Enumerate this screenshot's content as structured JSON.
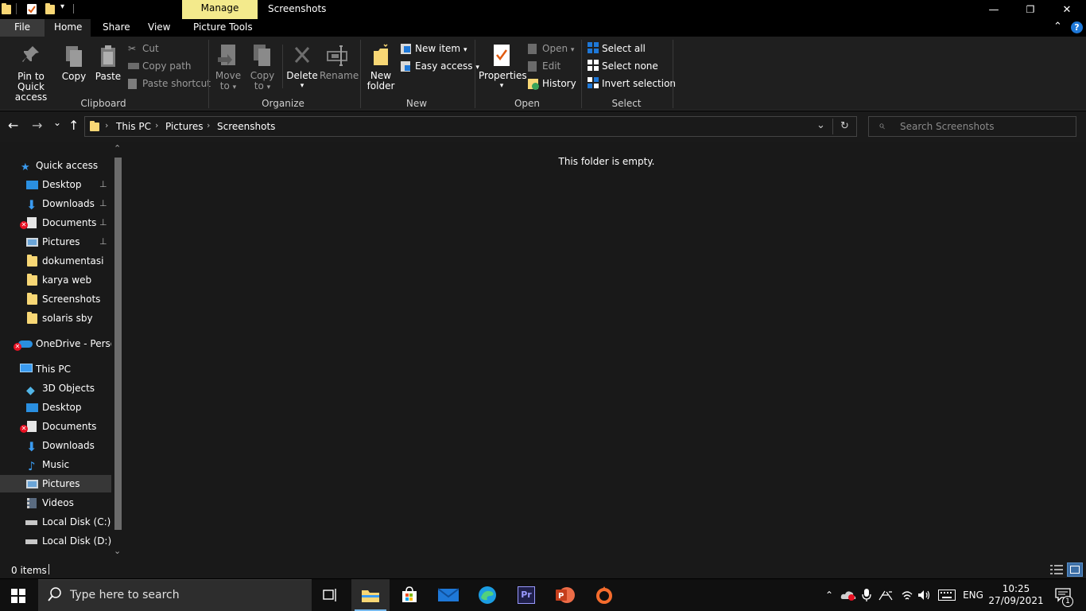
{
  "window": {
    "title": "Screenshots",
    "contextual_tab": "Manage",
    "minimize_glyph": "—",
    "maximize_glyph": "❐",
    "close_glyph": "✕"
  },
  "ribbon_tabs": {
    "file": "File",
    "home": "Home",
    "share": "Share",
    "view": "View",
    "picture_tools": "Picture Tools",
    "collapse_glyph": "⌃",
    "help_glyph": "?"
  },
  "ribbon": {
    "clipboard": {
      "pin_label_1": "Pin to Quick",
      "pin_label_2": "access",
      "copy": "Copy",
      "paste": "Paste",
      "cut": "Cut",
      "copy_path": "Copy path",
      "paste_shortcut": "Paste shortcut",
      "group": "Clipboard"
    },
    "organize": {
      "move_1": "Move",
      "move_2": "to",
      "copy_1": "Copy",
      "copy_2": "to",
      "delete": "Delete",
      "rename": "Rename",
      "group": "Organize"
    },
    "new": {
      "new_item": "New item",
      "easy_access": "Easy access",
      "new_folder_1": "New",
      "new_folder_2": "folder",
      "group": "New"
    },
    "open": {
      "properties": "Properties",
      "open": "Open",
      "edit": "Edit",
      "history": "History",
      "group": "Open"
    },
    "select": {
      "select_all": "Select all",
      "select_none": "Select none",
      "invert": "Invert selection",
      "group": "Select"
    }
  },
  "navbar": {
    "back_glyph": "←",
    "forward_glyph": "→",
    "recent_glyph": "⌄",
    "up_glyph": "↑",
    "breadcrumb": [
      "This PC",
      "Pictures",
      "Screenshots"
    ],
    "crumb_sep": "›",
    "dropdown_glyph": "⌄",
    "refresh_glyph": "↻",
    "search_placeholder": "Search Screenshots",
    "search_glyph": "⌕"
  },
  "navpane": {
    "quick_access": "Quick access",
    "qa_items": [
      "Desktop",
      "Downloads",
      "Documents",
      "Pictures",
      "dokumentasi",
      "karya web",
      "Screenshots",
      "solaris sby"
    ],
    "onedrive": "OneDrive - Personal",
    "this_pc": "This PC",
    "pc_items": [
      "3D Objects",
      "Desktop",
      "Documents",
      "Downloads",
      "Music",
      "Pictures",
      "Videos",
      "Local Disk (C:)",
      "Local Disk (D:)"
    ],
    "pin_glyph": "📌",
    "scroll_up": "⌃",
    "scroll_down": "⌄"
  },
  "main": {
    "empty_message": "This folder is empty."
  },
  "statusbar": {
    "item_count": "0 items"
  },
  "taskbar": {
    "search_placeholder": "Type here to search",
    "language": "ENG",
    "time": "10:25",
    "date": "27/09/2021",
    "notification_count": "1"
  },
  "colors": {
    "folder": "#f8d775",
    "accent_blue": "#1e90ff",
    "manage_tab": "#f3ea8c",
    "error_red": "#e81123"
  }
}
